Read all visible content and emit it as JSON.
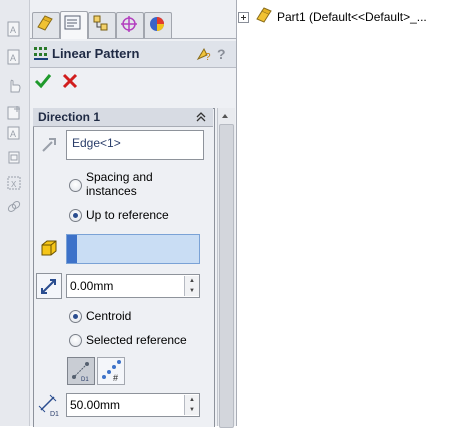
{
  "tree": {
    "root_label": "Part1  (Default<<Default>_..."
  },
  "panel": {
    "title": "Linear Pattern",
    "direction": {
      "header": "Direction 1",
      "edge_value": "Edge<1>",
      "option_spacing": "Spacing and instances",
      "option_spacing_l1": "Spacing and",
      "option_spacing_l2": "instances",
      "option_uptoref": "Up to reference",
      "selected_option": "Up to reference",
      "offset_value": "0.00mm",
      "option_centroid": "Centroid",
      "option_selected_ref": "Selected reference",
      "selected_ref_option": "Centroid",
      "spacing_value": "50.00mm"
    }
  },
  "colors": {
    "accent": "#3d72c9",
    "ok": "#1f9a2c",
    "cancel": "#d11d1d",
    "reference_field": "#c9ddf4"
  }
}
